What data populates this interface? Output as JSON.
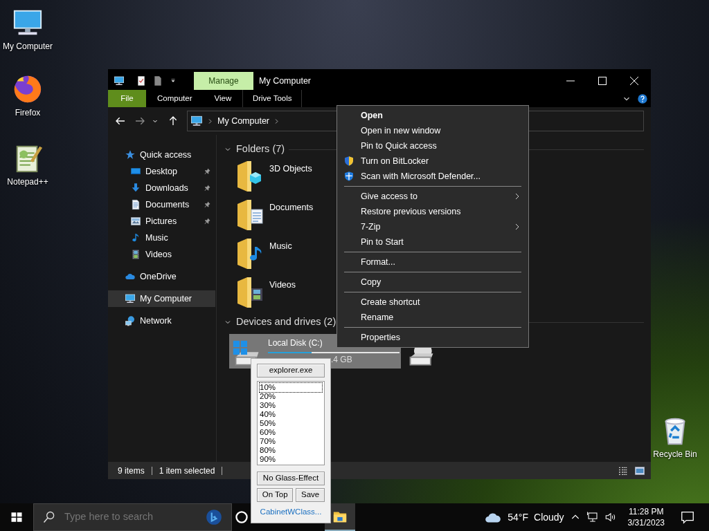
{
  "desktop_icons": [
    {
      "label": "My Computer",
      "kind": "computer"
    },
    {
      "label": "Firefox",
      "kind": "firefox"
    },
    {
      "label": "Notepad++",
      "kind": "notepad"
    },
    {
      "label": "Recycle Bin",
      "kind": "recycle"
    }
  ],
  "explorer": {
    "title": "My Computer",
    "contextual_tab": "Manage",
    "ribbon_tabs": [
      {
        "label": "File",
        "kind": "file",
        "selected": false
      },
      {
        "label": "Computer",
        "kind": "tab",
        "selected": false
      },
      {
        "label": "View",
        "kind": "tab",
        "selected": false
      },
      {
        "label": "Drive Tools",
        "kind": "contextual",
        "selected": false
      }
    ],
    "address": "My Computer",
    "navigation": [
      {
        "label": "Quick access",
        "kind": "star",
        "selected": false,
        "children": [
          {
            "label": "Desktop",
            "kind": "desktop",
            "selected": false,
            "pinned": true
          },
          {
            "label": "Downloads",
            "kind": "downloads",
            "selected": false,
            "pinned": true
          },
          {
            "label": "Documents",
            "kind": "documents",
            "selected": false,
            "pinned": true
          },
          {
            "label": "Pictures",
            "kind": "pictures",
            "selected": false,
            "pinned": true
          },
          {
            "label": "Music",
            "kind": "music",
            "selected": false,
            "pinned": false
          },
          {
            "label": "Videos",
            "kind": "videos",
            "selected": false,
            "pinned": false
          }
        ]
      },
      {
        "label": "OneDrive",
        "kind": "onedrive",
        "selected": false
      },
      {
        "label": "My Computer",
        "kind": "computer",
        "selected": true
      },
      {
        "label": "Network",
        "kind": "network",
        "selected": false
      }
    ],
    "folders": {
      "title": "Folders (7)",
      "items": [
        {
          "label": "3D Objects",
          "kind": "cube"
        },
        {
          "label": "Documents",
          "kind": "documents"
        },
        {
          "label": "Music",
          "kind": "music"
        },
        {
          "label": "Videos",
          "kind": "videos"
        }
      ]
    },
    "drives": {
      "title": "Devices and drives (2)",
      "items": [
        {
          "label": "Local Disk (C:)",
          "kind": "system",
          "selected": true,
          "level": 0.33,
          "free": ".4 GB"
        },
        {
          "kind": "optical",
          "selected": false
        }
      ]
    },
    "status_bar": {
      "item_count": "9 items",
      "selection": "1 item selected"
    }
  },
  "context_menu": {
    "sections": [
      [
        {
          "label": "Open",
          "kind": "default"
        },
        {
          "label": "Open in new window",
          "kind": "plain"
        },
        {
          "label": "Pin to Quick access",
          "kind": "plain"
        },
        {
          "label": "Turn on BitLocker",
          "kind": "shield"
        },
        {
          "label": "Scan with Microsoft Defender...",
          "kind": "defender"
        }
      ],
      [
        {
          "label": "Give access to",
          "kind": "submenu"
        },
        {
          "label": "Restore previous versions",
          "kind": "plain"
        },
        {
          "label": "7-Zip",
          "kind": "submenu"
        },
        {
          "label": "Pin to Start",
          "kind": "plain"
        }
      ],
      [
        {
          "label": "Format...",
          "kind": "plain"
        }
      ],
      [
        {
          "label": "Copy",
          "kind": "plain"
        }
      ],
      [
        {
          "label": "Create shortcut",
          "kind": "plain"
        },
        {
          "label": "Rename",
          "kind": "plain"
        }
      ],
      [
        {
          "label": "Properties",
          "kind": "plain"
        }
      ]
    ]
  },
  "popup": {
    "process": "explorer.exe",
    "levels": [
      {
        "label": "10%",
        "selected": true
      },
      {
        "label": "20%",
        "selected": false
      },
      {
        "label": "30%",
        "selected": false
      },
      {
        "label": "40%",
        "selected": false
      },
      {
        "label": "50%",
        "selected": false
      },
      {
        "label": "60%",
        "selected": false
      },
      {
        "label": "70%",
        "selected": false
      },
      {
        "label": "80%",
        "selected": false
      },
      {
        "label": "90%",
        "selected": false
      }
    ],
    "buttons": [
      "No Glass-Effect",
      "On Top",
      "Save"
    ],
    "link": "CabinetWClass..."
  },
  "taskbar": {
    "search_placeholder": "Type here to search",
    "apps": [
      {
        "kind": "cortana",
        "selected": false
      },
      {
        "kind": "explorer",
        "selected": true
      }
    ],
    "weather": {
      "temperature": "54°F",
      "condition": "Cloudy"
    },
    "time": "11:28 PM",
    "date": "3/31/2023"
  }
}
